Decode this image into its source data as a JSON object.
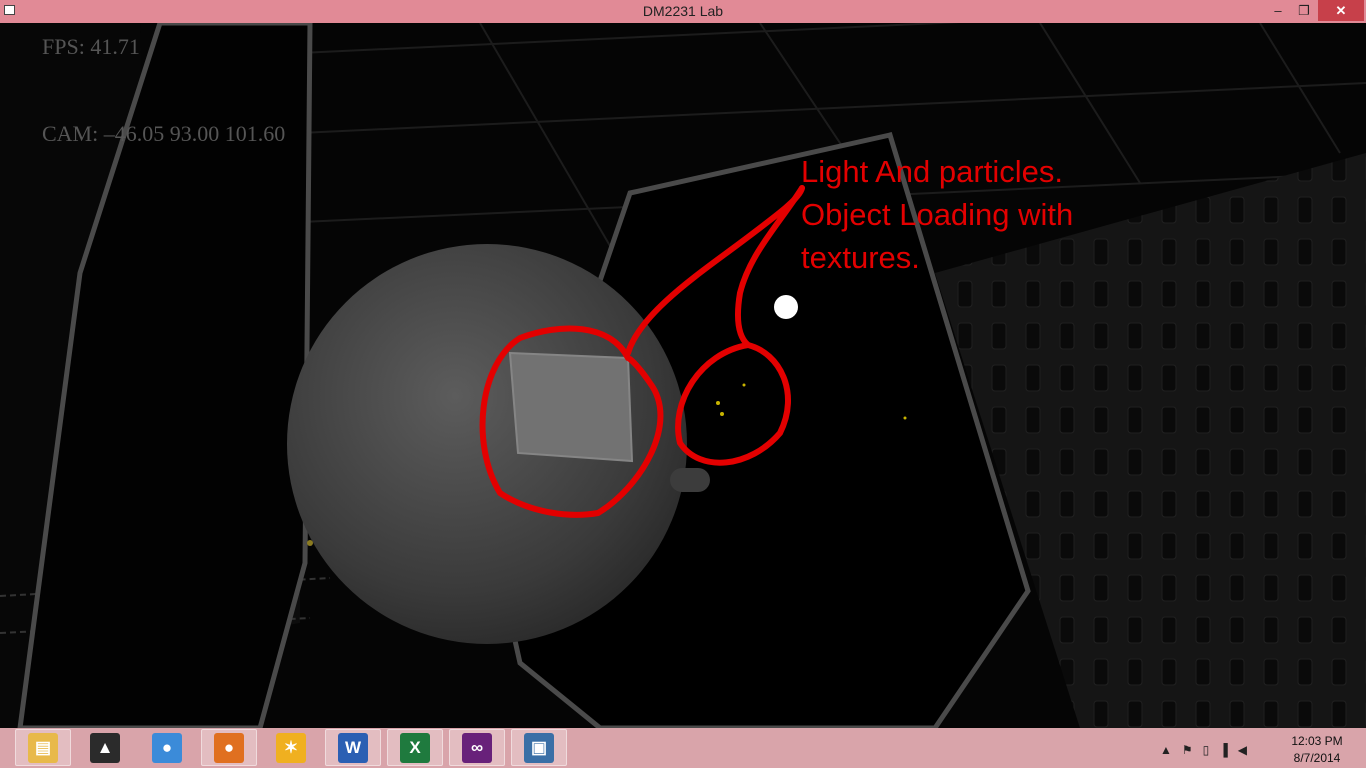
{
  "window": {
    "title": "DM2231 Lab",
    "minimize_label": "–",
    "maximize_label": "❐",
    "close_label": "✕"
  },
  "hud": {
    "fps": "FPS: 41.71",
    "cam": "CAM: –46.05 93.00 101.60"
  },
  "annotation": {
    "text": "Light And particles.\nObject Loading with\ntextures.",
    "color": "#e30000"
  },
  "taskbar": {
    "items": [
      {
        "name": "file-explorer-icon",
        "glyph": "▤",
        "color": "#e8b94a",
        "active": true
      },
      {
        "name": "app-hat-icon",
        "glyph": "▲",
        "color": "#2b2b2b",
        "active": false
      },
      {
        "name": "chrome-icon",
        "glyph": "●",
        "color": "#3b8bd9",
        "active": false
      },
      {
        "name": "firefox-icon",
        "glyph": "●",
        "color": "#e07020",
        "active": true
      },
      {
        "name": "keys-app-icon",
        "glyph": "✶",
        "color": "#f0b020",
        "active": false
      },
      {
        "name": "word-icon",
        "glyph": "W",
        "color": "#2b5fb3",
        "active": true
      },
      {
        "name": "excel-icon",
        "glyph": "X",
        "color": "#1f7a3e",
        "active": true
      },
      {
        "name": "visual-studio-icon",
        "glyph": "∞",
        "color": "#68217a",
        "active": true
      },
      {
        "name": "dm2231-lab-window-icon",
        "glyph": "▣",
        "color": "#3a6fa6",
        "active": true
      }
    ],
    "tray_icons": [
      "show-hidden-icons-icon",
      "action-center-flag-icon",
      "device-icon",
      "network-signal-icon",
      "volume-icon"
    ],
    "tray_glyphs": [
      "▲",
      "⚑",
      "▯",
      "▐",
      "◀"
    ],
    "time": "12:03 PM",
    "date": "8/7/2014"
  }
}
